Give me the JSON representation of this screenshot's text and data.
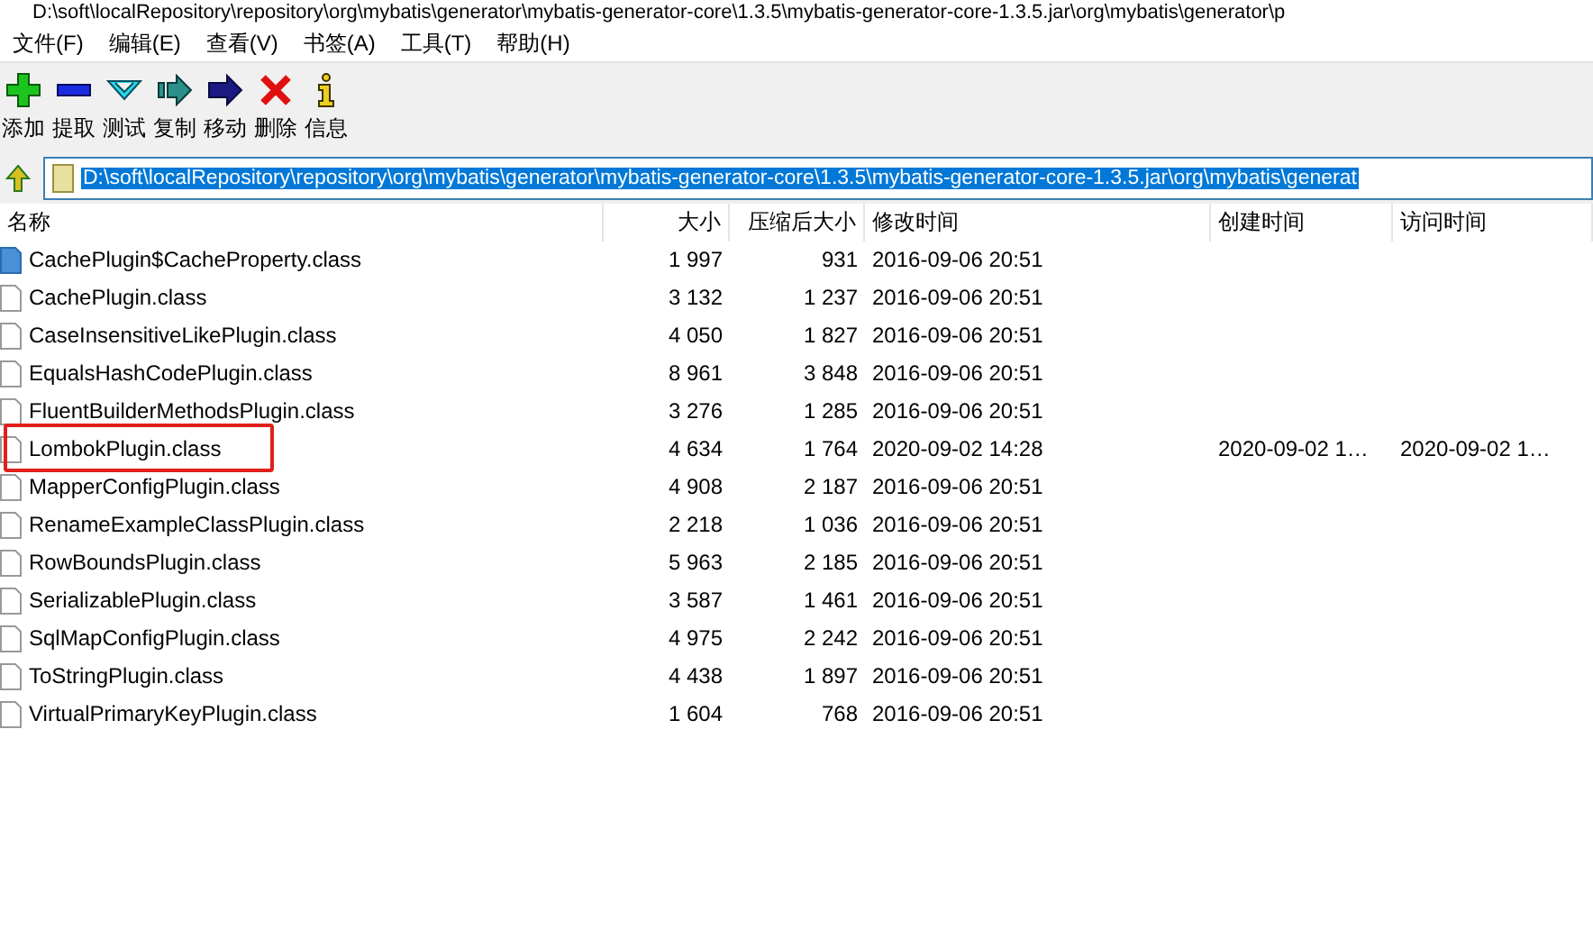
{
  "window": {
    "title": "D:\\soft\\localRepository\\repository\\org\\mybatis\\generator\\mybatis-generator-core\\1.3.5\\mybatis-generator-core-1.3.5.jar\\org\\mybatis\\generator\\p"
  },
  "menu": [
    "文件(F)",
    "编辑(E)",
    "查看(V)",
    "书签(A)",
    "工具(T)",
    "帮助(H)"
  ],
  "toolbar": [
    {
      "label": "添加",
      "kind": "add"
    },
    {
      "label": "提取",
      "kind": "extract"
    },
    {
      "label": "测试",
      "kind": "test"
    },
    {
      "label": "复制",
      "kind": "copy"
    },
    {
      "label": "移动",
      "kind": "move"
    },
    {
      "label": "删除",
      "kind": "delete"
    },
    {
      "label": "信息",
      "kind": "info"
    }
  ],
  "address": {
    "value": "D:\\soft\\localRepository\\repository\\org\\mybatis\\generator\\mybatis-generator-core\\1.3.5\\mybatis-generator-core-1.3.5.jar\\org\\mybatis\\generat"
  },
  "table": {
    "columns": [
      "名称",
      "大小",
      "压缩后大小",
      "修改时间",
      "创建时间",
      "访问时间"
    ],
    "rows": [
      {
        "name": "CachePlugin$CacheProperty.class",
        "size": "1 997",
        "packed": "931",
        "modified": "2016-09-06 20:51",
        "focused": true,
        "highlighted": false
      },
      {
        "name": "CachePlugin.class",
        "size": "3 132",
        "packed": "1 237",
        "modified": "2016-09-06 20:51",
        "focused": false,
        "highlighted": false
      },
      {
        "name": "CaseInsensitiveLikePlugin.class",
        "size": "4 050",
        "packed": "1 827",
        "modified": "2016-09-06 20:51",
        "focused": false,
        "highlighted": false
      },
      {
        "name": "EqualsHashCodePlugin.class",
        "size": "8 961",
        "packed": "3 848",
        "modified": "2016-09-06 20:51",
        "focused": false,
        "highlighted": false
      },
      {
        "name": "FluentBuilderMethodsPlugin.class",
        "size": "3 276",
        "packed": "1 285",
        "modified": "2016-09-06 20:51",
        "focused": false,
        "highlighted": false
      },
      {
        "name": "LombokPlugin.class",
        "size": "4 634",
        "packed": "1 764",
        "modified": "2020-09-02 14:28",
        "created": "2020-09-02 1…",
        "accessed": "2020-09-02 1…",
        "focused": false,
        "highlighted": true
      },
      {
        "name": "MapperConfigPlugin.class",
        "size": "4 908",
        "packed": "2 187",
        "modified": "2016-09-06 20:51",
        "focused": false,
        "highlighted": false
      },
      {
        "name": "RenameExampleClassPlugin.class",
        "size": "2 218",
        "packed": "1 036",
        "modified": "2016-09-06 20:51",
        "focused": false,
        "highlighted": false
      },
      {
        "name": "RowBoundsPlugin.class",
        "size": "5 963",
        "packed": "2 185",
        "modified": "2016-09-06 20:51",
        "focused": false,
        "highlighted": false
      },
      {
        "name": "SerializablePlugin.class",
        "size": "3 587",
        "packed": "1 461",
        "modified": "2016-09-06 20:51",
        "focused": false,
        "highlighted": false
      },
      {
        "name": "SqlMapConfigPlugin.class",
        "size": "4 975",
        "packed": "2 242",
        "modified": "2016-09-06 20:51",
        "focused": false,
        "highlighted": false
      },
      {
        "name": "ToStringPlugin.class",
        "size": "4 438",
        "packed": "1 897",
        "modified": "2016-09-06 20:51",
        "focused": false,
        "highlighted": false
      },
      {
        "name": "VirtualPrimaryKeyPlugin.class",
        "size": "1 604",
        "packed": "768",
        "modified": "2016-09-06 20:51",
        "focused": false,
        "highlighted": false
      }
    ]
  }
}
